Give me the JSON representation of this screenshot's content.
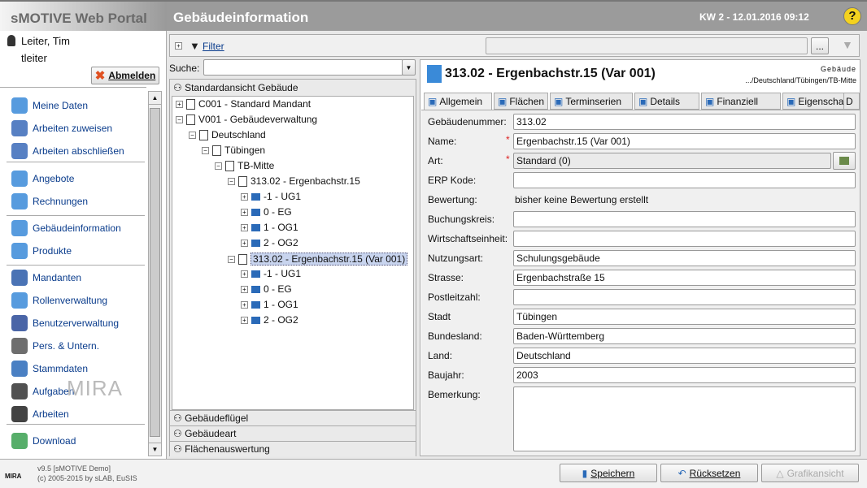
{
  "app_title": "sMOTIVE Web Portal",
  "page_title": "Gebäudeinformation",
  "date": "KW 2 - 12.01.2016 09:12",
  "user": {
    "name": "Leiter, Tim",
    "login": "tleiter",
    "logout": "Abmelden"
  },
  "menu": [
    {
      "label": "Meine Daten",
      "icon": "user-info-icon"
    },
    {
      "label": "Arbeiten zuweisen",
      "icon": "assign-work-icon"
    },
    {
      "label": "Arbeiten abschließen",
      "icon": "complete-work-icon"
    },
    {
      "label": "Angebote",
      "icon": "offer-icon"
    },
    {
      "label": "Rechnungen",
      "icon": "invoice-icon"
    },
    {
      "label": "Gebäudeinformation",
      "icon": "building-icon"
    },
    {
      "label": "Produkte",
      "icon": "product-icon"
    },
    {
      "label": "Mandanten",
      "icon": "client-icon"
    },
    {
      "label": "Rollenverwaltung",
      "icon": "roles-icon"
    },
    {
      "label": "Benutzerverwaltung",
      "icon": "users-icon"
    },
    {
      "label": "Pers. & Untern.",
      "icon": "persons-icon"
    },
    {
      "label": "Stammdaten",
      "icon": "master-data-icon"
    },
    {
      "label": "Aufgaben",
      "icon": "wrench-icon"
    },
    {
      "label": "Arbeiten",
      "icon": "gear-icon"
    },
    {
      "label": "Download",
      "icon": "download-icon"
    }
  ],
  "watermark": "MIRA",
  "filter": {
    "label": "Filter",
    "more": "..."
  },
  "search": {
    "label": "Suche:",
    "value": ""
  },
  "tree": {
    "header": "Standardansicht Gebäude",
    "nodes": [
      {
        "label": "C001 - Standard Mandant",
        "level": 0,
        "pm": "+"
      },
      {
        "label": "V001 - Gebäudeverwaltung",
        "level": 0,
        "pm": "-"
      },
      {
        "label": "Deutschland",
        "level": 1,
        "pm": "-"
      },
      {
        "label": "Tübingen",
        "level": 2,
        "pm": "-"
      },
      {
        "label": "TB-Mitte",
        "level": 3,
        "pm": "-"
      },
      {
        "label": "313.02 - Ergenbachstr.15",
        "level": 4,
        "pm": "-"
      },
      {
        "label": "-1 - UG1",
        "level": 5,
        "pm": "+"
      },
      {
        "label": "0 - EG",
        "level": 5,
        "pm": "+"
      },
      {
        "label": "1 - OG1",
        "level": 5,
        "pm": "+"
      },
      {
        "label": "2 - OG2",
        "level": 5,
        "pm": "+"
      },
      {
        "label": "313.02 - Ergenbachstr.15 (Var 001)",
        "level": 4,
        "pm": "-",
        "selected": true
      },
      {
        "label": "-1 - UG1",
        "level": 5,
        "pm": "+"
      },
      {
        "label": "0 - EG",
        "level": 5,
        "pm": "+"
      },
      {
        "label": "1 - OG1",
        "level": 5,
        "pm": "+"
      },
      {
        "label": "2 - OG2",
        "level": 5,
        "pm": "+"
      }
    ],
    "sections": [
      "Gebäudeflügel",
      "Gebäudeart",
      "Flächenauswertung"
    ]
  },
  "detail": {
    "title": "313.02 - Ergenbachstr.15 (Var 001)",
    "type": "Gebäude",
    "path": ".../Deutschland/Tübingen/TB-Mitte",
    "tabs": [
      "Allgemein",
      "Flächen",
      "Terminserien",
      "Details",
      "Finanziell",
      "Eigenschaften",
      "D"
    ],
    "fields": [
      {
        "label": "Gebäudenummer:",
        "value": "313.02"
      },
      {
        "label": "Name:",
        "value": "Ergenbachstr.15 (Var 001)",
        "required": true
      },
      {
        "label": "Art:",
        "value": "Standard (0)",
        "required": true,
        "readonly": true
      },
      {
        "label": "ERP Kode:",
        "value": ""
      },
      {
        "label": "Bewertung:",
        "value": "bisher keine Bewertung erstellt",
        "static": true
      },
      {
        "label": "Buchungskreis:",
        "value": ""
      },
      {
        "label": "Wirtschaftseinheit:",
        "value": ""
      },
      {
        "label": "Nutzungsart:",
        "value": "Schulungsgebäude"
      },
      {
        "label": "Strasse:",
        "value": "Ergenbachstraße 15"
      },
      {
        "label": "Postleitzahl:",
        "value": ""
      },
      {
        "label": "Stadt",
        "value": "Tübingen"
      },
      {
        "label": "Bundesland:",
        "value": "Baden-Württemberg"
      },
      {
        "label": "Land:",
        "value": "Deutschland"
      },
      {
        "label": "Baujahr:",
        "value": "2003"
      },
      {
        "label": "Bemerkung:",
        "value": ""
      }
    ]
  },
  "footer": {
    "version": "v9.5 [sMOTIVE Demo]",
    "copyright": "(c) 2005-2015 by sLAB, EuSIS",
    "logo": "MIRA",
    "save": "Speichern",
    "reset": "Rücksetzen",
    "graphic": "Grafikansicht"
  }
}
